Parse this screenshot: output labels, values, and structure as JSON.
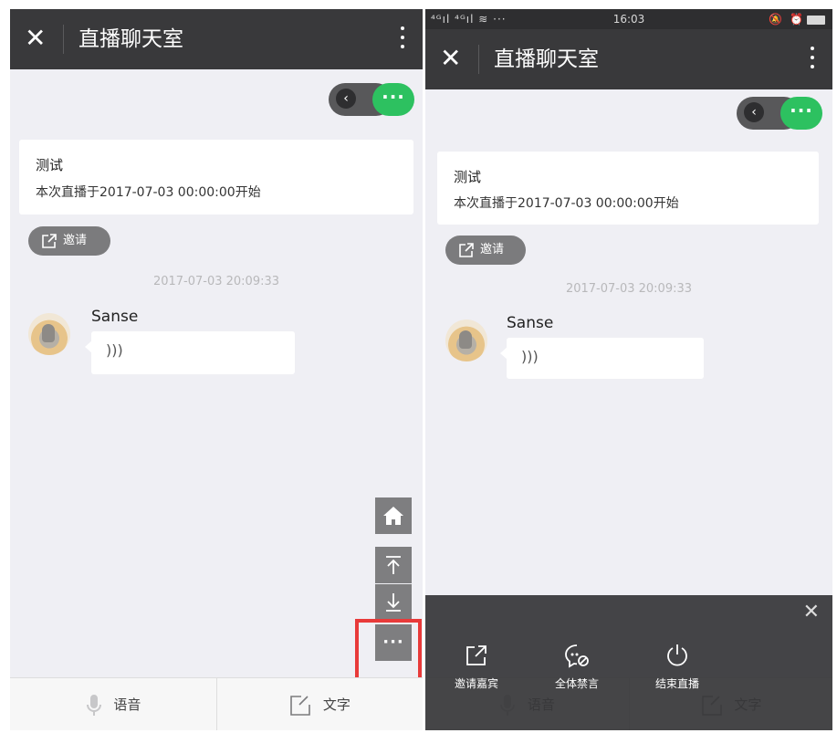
{
  "left": {
    "header": {
      "close": "✕",
      "title": "直播聊天室"
    },
    "card": {
      "title": "测试",
      "subtitle": "本次直播于2017-07-03 00:00:00开始"
    },
    "invite_label": "邀请",
    "timestamp": "2017-07-03 20:09:33",
    "message": {
      "user": "Sanse",
      "voice_icon": ")))"
    },
    "bottom": {
      "voice_label": "语音",
      "text_label": "文字"
    }
  },
  "right": {
    "status": {
      "signal": "⁴ᴳıl ⁴ᴳıl ≋ ···",
      "time": "16:03",
      "icons": "🔕 ⏰"
    },
    "header": {
      "close": "✕",
      "title": "直播聊天室"
    },
    "card": {
      "title": "测试",
      "subtitle": "本次直播于2017-07-03 00:00:00开始"
    },
    "invite_label": "邀请",
    "timestamp": "2017-07-03 20:09:33",
    "message": {
      "user": "Sanse",
      "voice_icon": ")))"
    },
    "bottom": {
      "voice_label": "语音",
      "text_label": "文字"
    },
    "action_sheet": {
      "close": "✕",
      "actions": [
        {
          "label": "邀请嘉宾",
          "icon": "share-edit-icon"
        },
        {
          "label": "全体禁言",
          "icon": "chat-mute-icon"
        },
        {
          "label": "结束直播",
          "icon": "power-icon"
        }
      ]
    }
  },
  "colors": {
    "header": "#39393b",
    "accent_green": "#2dc160",
    "highlight_red": "#e83a3a"
  }
}
